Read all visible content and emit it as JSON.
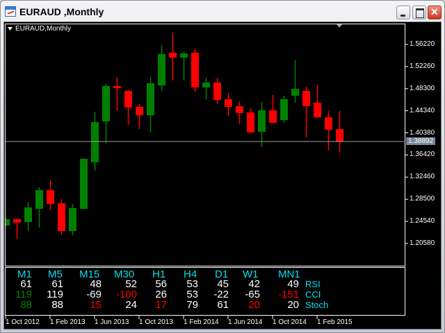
{
  "window": {
    "title": "EURAUD ,Monthly"
  },
  "chart": {
    "label": "EURAUD,Monthly",
    "symbol": "EURAUD",
    "timeframe": "Monthly",
    "current_price": "1.38892",
    "price_ticks": [
      "1.56220",
      "1.52260",
      "1.48300",
      "1.44340",
      "1.40380",
      "1.36420",
      "1.32460",
      "1.28500",
      "1.24540",
      "1.20580"
    ],
    "time_ticks": [
      "1 Oct 2012",
      "1 Feb 2013",
      "1 Jun 2013",
      "1 Oct 2013",
      "1 Feb 2014",
      "1 Jun 2014",
      "1 Oct 2014",
      "1 Feb 2015"
    ],
    "colors": {
      "bull": "#008000",
      "bear": "#ff0000",
      "bg": "#000000",
      "grid_line": "#a0a0a0"
    },
    "candles": [
      [
        1.238,
        1.2517,
        1.2368,
        1.2492
      ],
      [
        1.2492,
        1.2505,
        1.2144,
        1.243
      ],
      [
        1.2442,
        1.2803,
        1.2281,
        1.2703
      ],
      [
        1.2678,
        1.3064,
        1.2343,
        1.3014
      ],
      [
        1.3014,
        1.3188,
        1.2654,
        1.2766
      ],
      [
        1.2778,
        1.2852,
        1.2206,
        1.2281
      ],
      [
        1.2281,
        1.2766,
        1.2206,
        1.2691
      ],
      [
        1.2678,
        1.3585,
        1.2666,
        1.3573
      ],
      [
        1.3511,
        1.4417,
        1.3362,
        1.4231
      ],
      [
        1.4243,
        1.4914,
        1.3846,
        1.4877
      ],
      [
        1.4877,
        1.5038,
        1.443,
        1.484
      ],
      [
        1.479,
        1.4802,
        1.4181,
        1.4492
      ],
      [
        1.4504,
        1.4554,
        1.4107,
        1.4355
      ],
      [
        1.4355,
        1.5038,
        1.4045,
        1.4927
      ],
      [
        1.4889,
        1.561,
        1.479,
        1.5448
      ],
      [
        1.5473,
        1.5833,
        1.4976,
        1.5386
      ],
      [
        1.5386,
        1.5498,
        1.4976,
        1.5461
      ],
      [
        1.5473,
        1.5547,
        1.4765,
        1.4852
      ],
      [
        1.4852,
        1.5026,
        1.4641,
        1.4939
      ],
      [
        1.4939,
        1.5026,
        1.4554,
        1.4628
      ],
      [
        1.4641,
        1.4753,
        1.4343,
        1.4504
      ],
      [
        1.4517,
        1.4604,
        1.4194,
        1.4393
      ],
      [
        1.4405,
        1.4479,
        1.4045,
        1.4045
      ],
      [
        1.4057,
        1.4591,
        1.3784,
        1.4442
      ],
      [
        1.4442,
        1.4715,
        1.4206,
        1.4219
      ],
      [
        1.4268,
        1.4703,
        1.4219,
        1.4641
      ],
      [
        1.4703,
        1.5336,
        1.4579,
        1.4827
      ],
      [
        1.479,
        1.4864,
        1.3958,
        1.4517
      ],
      [
        1.4579,
        1.4902,
        1.4306,
        1.4318
      ],
      [
        1.4318,
        1.443,
        1.3722,
        1.4094
      ],
      [
        1.4107,
        1.443,
        1.3685,
        1.38892
      ]
    ]
  },
  "indicator_panel": {
    "timeframes": [
      "M1",
      "M5",
      "M15",
      "M30",
      "H1",
      "H4",
      "D1",
      "W1",
      "MN1"
    ],
    "rows": [
      {
        "label": "RSI",
        "values": [
          "61",
          "61",
          "48",
          "52",
          "56",
          "53",
          "45",
          "42",
          "49"
        ],
        "colors": [
          "#ffffff",
          "#ffffff",
          "#ffffff",
          "#ffffff",
          "#ffffff",
          "#ffffff",
          "#ffffff",
          "#ffffff",
          "#ffffff"
        ]
      },
      {
        "label": "CCI",
        "values": [
          "119",
          "119",
          "-69",
          "-100",
          "26",
          "53",
          "-22",
          "-65",
          "-151"
        ],
        "colors": [
          "#008000",
          "#ffffff",
          "#ffffff",
          "#ff0000",
          "#ffffff",
          "#ffffff",
          "#ffffff",
          "#ffffff",
          "#ff0000"
        ]
      },
      {
        "label": "Stoch",
        "values": [
          "88",
          "88",
          "15",
          "24",
          "17",
          "79",
          "61",
          "20",
          "20"
        ],
        "colors": [
          "#008000",
          "#ffffff",
          "#ff0000",
          "#ffffff",
          "#ff0000",
          "#ffffff",
          "#ffffff",
          "#ff0000",
          "#ffffff"
        ]
      }
    ]
  }
}
